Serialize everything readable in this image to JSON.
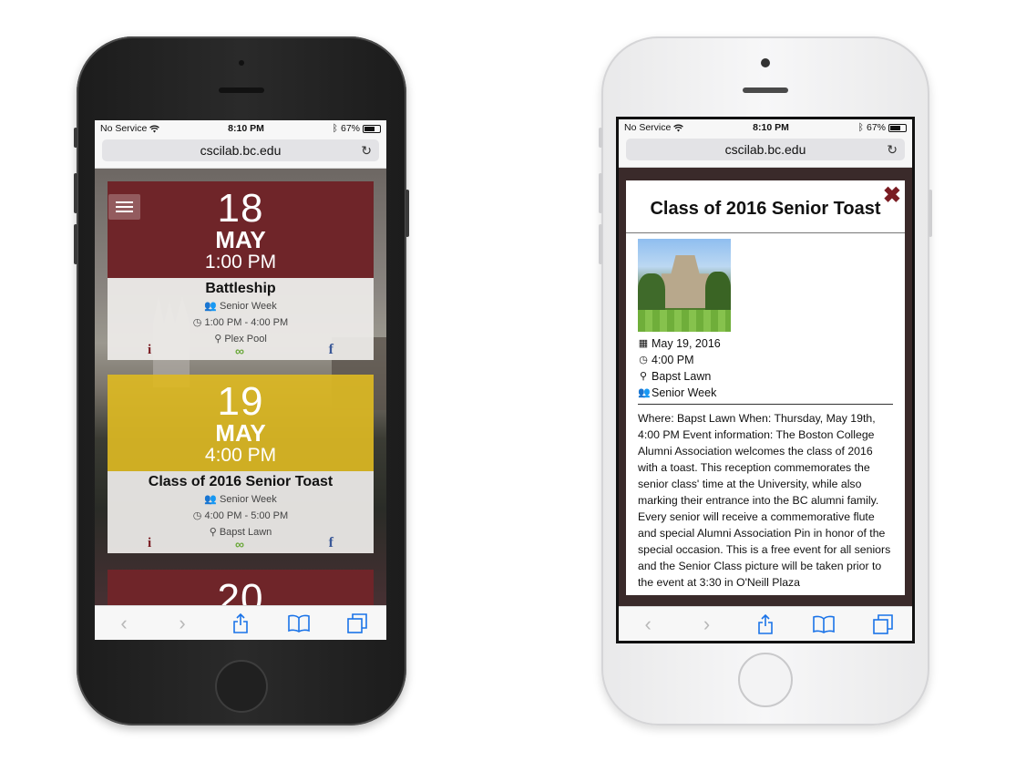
{
  "status": {
    "carrier": "No Service",
    "time": "8:10 PM",
    "battery": "67%"
  },
  "browser": {
    "url": "cscilab.bc.edu"
  },
  "events": [
    {
      "day": "18",
      "month": "MAY",
      "time": "1:00 PM",
      "title": "Battleship",
      "category": "Senior Week",
      "timerange": "1:00 PM - 4:00 PM",
      "location": "Plex Pool"
    },
    {
      "day": "19",
      "month": "MAY",
      "time": "4:00 PM",
      "title": "Class of 2016 Senior Toast",
      "category": "Senior Week",
      "timerange": "4:00 PM - 5:00 PM",
      "location": "Bapst Lawn"
    },
    {
      "day": "20"
    }
  ],
  "icons": {
    "info": "i",
    "facebook": "f"
  },
  "modal": {
    "title": "Class of 2016 Senior Toast",
    "close": "✖",
    "date": "May 19, 2016",
    "time": "4:00 PM",
    "location": "Bapst Lawn",
    "category": "Senior Week",
    "description": "Where: Bapst Lawn When: Thursday, May 19th, 4:00 PM Event information: The Boston College Alumni Association welcomes the class of 2016 with a toast. This reception commemorates the senior class' time at the University, while also marking their entrance into the BC alumni family. Every senior will receive a commemorative flute and special Alumni Association Pin in honor of the special occasion. This is a free event for all seniors and the Senior Class picture will be taken prior to the event at 3:30 in O'Neill Plaza"
  },
  "colors": {
    "maroon": "#6f2529",
    "gold": "#dcb923",
    "link_blue": "#1a73e8"
  }
}
